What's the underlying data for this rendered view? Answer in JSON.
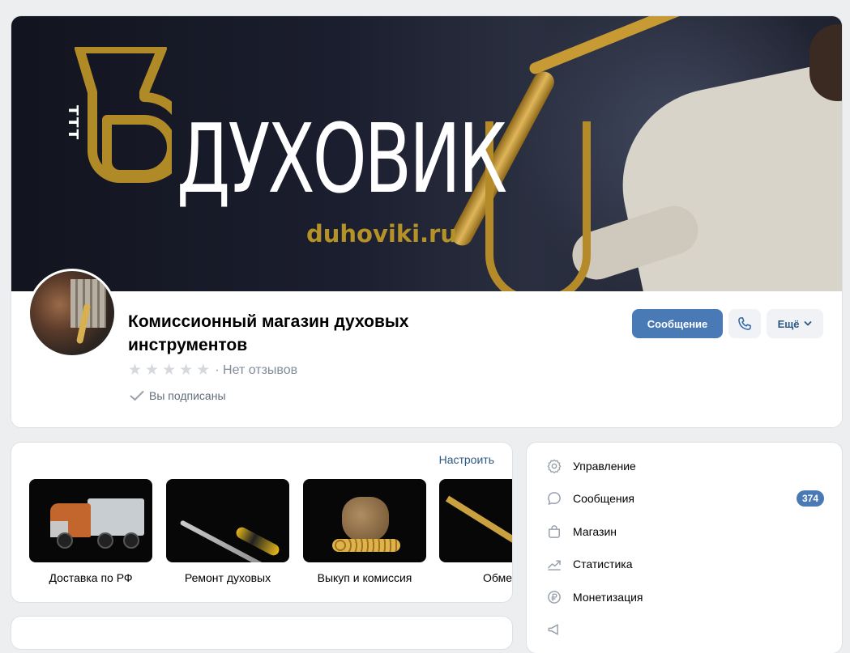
{
  "cover": {
    "brand_name": "ДУХОВИК",
    "brand_url": "duhoviki.ru",
    "logo_dots": "ттт",
    "accent_color": "#b59227"
  },
  "community": {
    "title": "Комиссионный магазин духовых инструментов",
    "rating_stars": 0,
    "rating_text": "Нет отзывов",
    "rating_separator": "·",
    "subscribed_text": "Вы подписаны"
  },
  "actions": {
    "message_label": "Сообщение",
    "call_icon": "phone-icon",
    "more_label": "Ещё",
    "primary_color": "#4a7ab5"
  },
  "services": {
    "configure_label": "Настроить",
    "items": [
      {
        "label": "Доставка по РФ",
        "icon": "truck"
      },
      {
        "label": "Ремонт духовых",
        "icon": "screwdriver"
      },
      {
        "label": "Выкуп и комиссия",
        "icon": "money-bag"
      },
      {
        "label": "Обме",
        "icon": "saxophone"
      }
    ]
  },
  "menu": {
    "items": [
      {
        "label": "Управление",
        "icon": "gear-icon"
      },
      {
        "label": "Сообщения",
        "icon": "message-icon",
        "badge": "374"
      },
      {
        "label": "Магазин",
        "icon": "bag-icon"
      },
      {
        "label": "Статистика",
        "icon": "stats-icon"
      },
      {
        "label": "Монетизация",
        "icon": "ruble-icon"
      }
    ]
  }
}
